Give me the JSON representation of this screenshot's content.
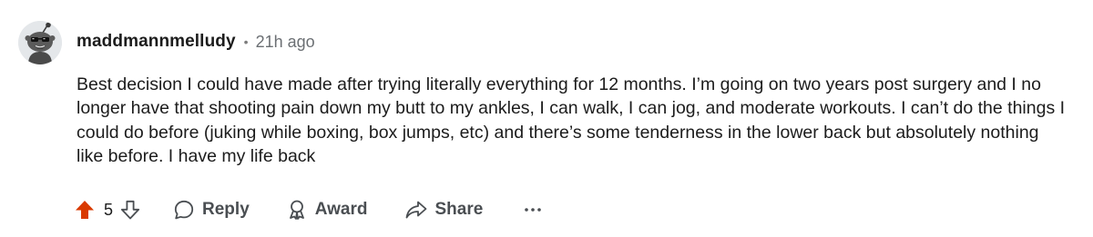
{
  "comment": {
    "username": "maddmannmelludy",
    "separator": "•",
    "timestamp": "21h ago",
    "text": "Best decision I could have made after trying literally everything for 12 months. I’m going on two years post surgery and I no longer have that shooting pain down my butt to my ankles, I can walk, I can jog, and moderate workouts. I can’t do the things I could do before (juking while boxing, box jumps, etc) and there’s some tenderness in the lower back but absolutely nothing like before. I have my life back",
    "avatar_icon": "snoo-avatar-icon"
  },
  "actions": {
    "upvote_icon": "upvote-arrow-icon",
    "upvote_color": "#d93a00",
    "vote_count": "5",
    "downvote_icon": "downvote-arrow-icon",
    "reply_label": "Reply",
    "reply_icon": "speech-bubble-icon",
    "award_label": "Award",
    "award_icon": "award-ribbon-icon",
    "share_label": "Share",
    "share_icon": "share-arrow-icon",
    "more_icon": "ellipsis-icon"
  }
}
